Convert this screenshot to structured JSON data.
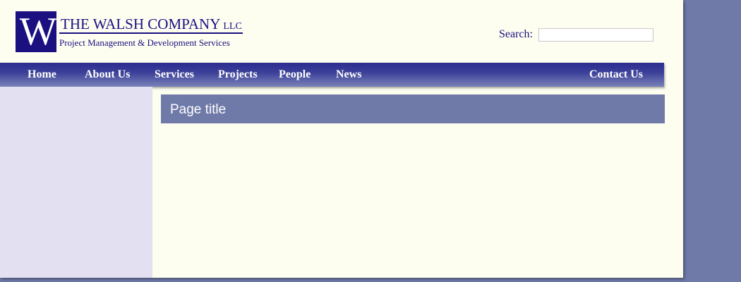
{
  "header": {
    "logo_letter": "W",
    "company_name": "THE WALSH COMPANY",
    "company_suffix": "LLC",
    "tagline": "Project Management & Development Services",
    "search_label": "Search:",
    "search_value": ""
  },
  "nav": {
    "items": [
      {
        "label": "Home"
      },
      {
        "label": "About Us"
      },
      {
        "label": "Services"
      },
      {
        "label": "Projects"
      },
      {
        "label": "People"
      },
      {
        "label": "News"
      },
      {
        "label": "Contact Us"
      }
    ]
  },
  "main": {
    "page_title": "Page title"
  },
  "colors": {
    "brand_navy": "#1a1080",
    "page_background": "#fdfdf0",
    "outer_background": "#6f7aa8",
    "sidebar_background": "#e2e0f1",
    "title_bar": "#6f7aa8"
  }
}
